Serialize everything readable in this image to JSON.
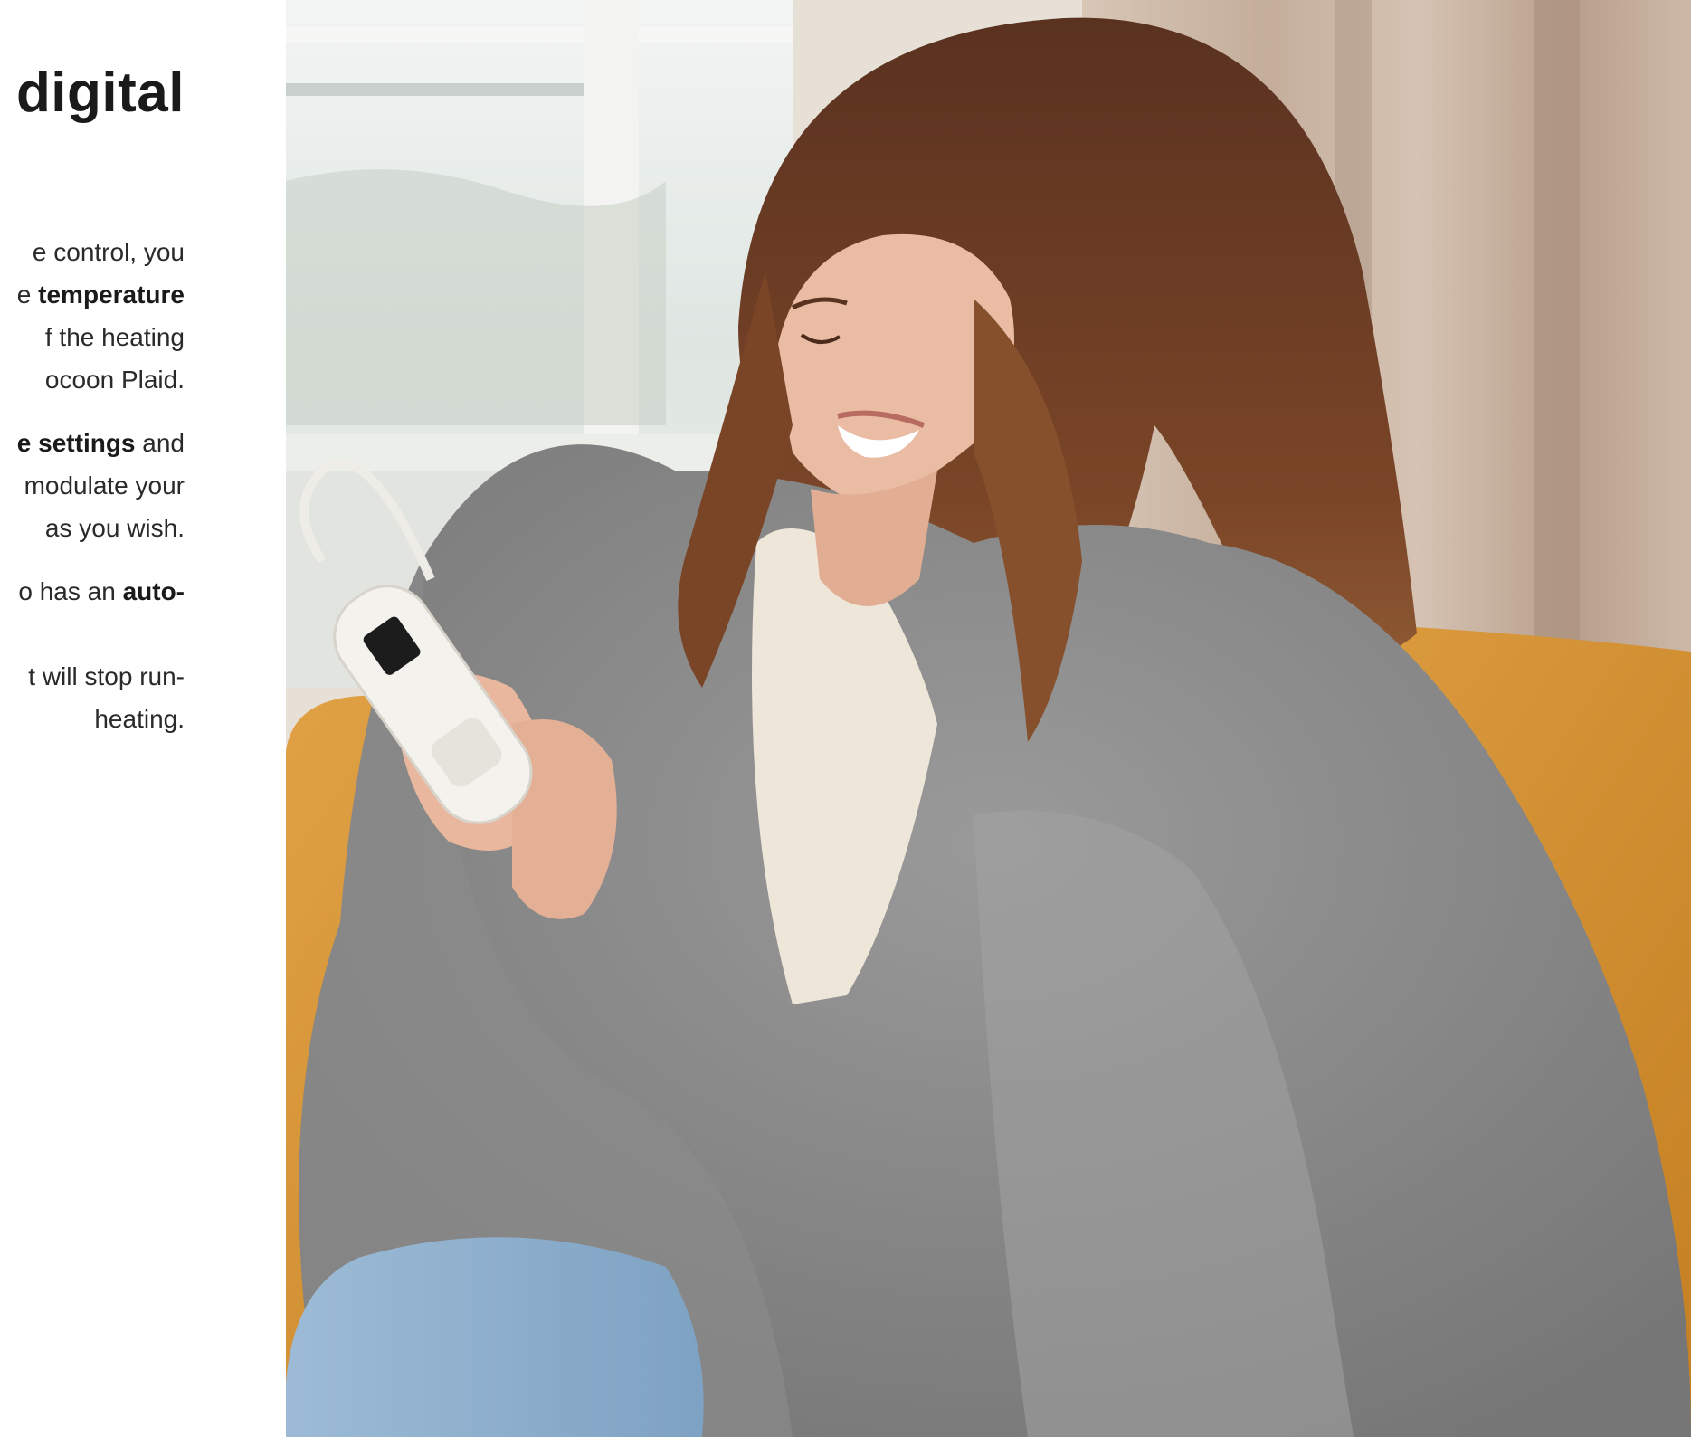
{
  "page": {
    "heading": "digital"
  },
  "text": {
    "p1": {
      "l1": "e control, you",
      "l2a": "e ",
      "l2b": "temperature",
      "l3": "f the heating",
      "l4": "ocoon Plaid."
    },
    "p2": {
      "l1a": "e settings",
      "l1b": " and",
      "l2": "modulate your",
      "l3": "as you wish."
    },
    "p3": {
      "l1a": "o has an ",
      "l1b": "auto-"
    },
    "p4": {
      "l1": "t will stop run-",
      "l2": "heating."
    }
  },
  "photo": {
    "subject": "woman-wrapped-in-grey-heated-plaid",
    "colors": {
      "window_light": "#e9eeec",
      "curtain": "#cbb7a6",
      "wall": "#e8e1d8",
      "sofa": "#d6902f",
      "blanket": "#8c8c8c",
      "hair": "#6e3d24",
      "skin": "#e7b89f",
      "sweater": "#efe6da",
      "jeans": "#8fb1cf",
      "remote": "#f3f1ec"
    }
  }
}
